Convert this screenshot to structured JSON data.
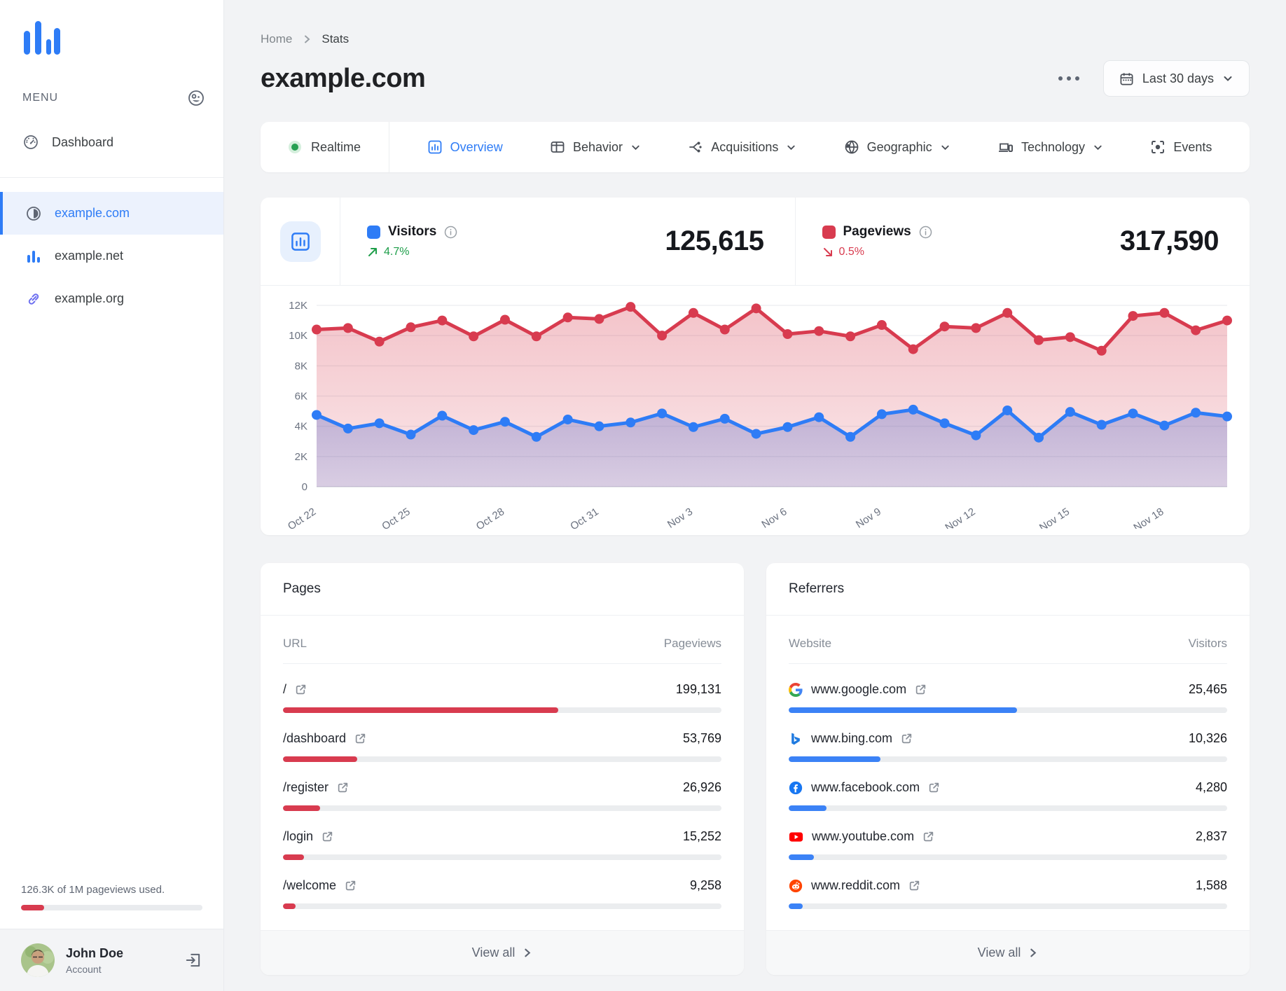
{
  "sidebar": {
    "menu_label": "MENU",
    "items": [
      {
        "label": "Dashboard",
        "icon": "gauge-icon"
      }
    ],
    "sites": [
      {
        "label": "example.com",
        "icon": "contrast-icon",
        "selected": true
      },
      {
        "label": "example.net",
        "icon": "bar-chart-icon",
        "selected": false
      },
      {
        "label": "example.org",
        "icon": "link-icon",
        "selected": false
      }
    ],
    "usage": {
      "text": "126.3K of 1M pageviews used.",
      "percent": 12.6
    },
    "account": {
      "name": "John Doe",
      "role": "Account"
    }
  },
  "header": {
    "breadcrumb": {
      "home": "Home",
      "current": "Stats"
    },
    "title": "example.com",
    "date_range": "Last 30 days"
  },
  "tabs": [
    {
      "label": "Realtime"
    },
    {
      "label": "Overview",
      "active": true
    },
    {
      "label": "Behavior",
      "dropdown": true
    },
    {
      "label": "Acquisitions",
      "dropdown": true
    },
    {
      "label": "Geographic",
      "dropdown": true
    },
    {
      "label": "Technology",
      "dropdown": true
    },
    {
      "label": "Events"
    }
  ],
  "stats": [
    {
      "label": "Visitors",
      "value": "125,615",
      "trend": "4.7%",
      "direction": "up",
      "color": "#2e7cf6"
    },
    {
      "label": "Pageviews",
      "value": "317,590",
      "trend": "0.5%",
      "direction": "down",
      "color": "#d83b4f"
    }
  ],
  "chart_data": {
    "type": "line",
    "x": [
      "Oct 22",
      "Oct 23",
      "Oct 24",
      "Oct 25",
      "Oct 26",
      "Oct 27",
      "Oct 28",
      "Oct 29",
      "Oct 30",
      "Oct 31",
      "Nov 1",
      "Nov 2",
      "Nov 3",
      "Nov 4",
      "Nov 5",
      "Nov 6",
      "Nov 7",
      "Nov 8",
      "Nov 9",
      "Nov 10",
      "Nov 11",
      "Nov 12",
      "Nov 13",
      "Nov 14",
      "Nov 15",
      "Nov 16",
      "Nov 17",
      "Nov 18",
      "Nov 19",
      "Nov 20"
    ],
    "label_every": 3,
    "shown_x_labels": [
      "Oct 22",
      "Oct 25",
      "Oct 28",
      "Oct 31",
      "Nov 3",
      "Nov 6",
      "Nov 9",
      "Nov 12",
      "Nov 15",
      "Nov 18"
    ],
    "series": [
      {
        "name": "Pageviews",
        "color": "#d83b4f",
        "values": [
          10400,
          10500,
          9600,
          10550,
          11000,
          9950,
          11050,
          9950,
          11200,
          11100,
          11900,
          10000,
          11500,
          10400,
          11800,
          10100,
          10300,
          9950,
          10700,
          9100,
          10600,
          10500,
          11500,
          9700,
          9900,
          9000,
          11300,
          11500,
          10350,
          11000
        ]
      },
      {
        "name": "Visitors",
        "color": "#2e7cf6",
        "values": [
          4750,
          3850,
          4200,
          3450,
          4700,
          3750,
          4300,
          3300,
          4450,
          4000,
          4250,
          4850,
          3950,
          4500,
          3500,
          3950,
          4600,
          3300,
          4800,
          5100,
          4200,
          3400,
          5050,
          3250,
          4950,
          4100,
          4850,
          4050,
          4900,
          4650
        ]
      }
    ],
    "ylim": [
      0,
      12000
    ],
    "yticks": [
      "0",
      "2K",
      "4K",
      "6K",
      "8K",
      "10K",
      "12K"
    ],
    "grid": true,
    "legend_position": "top-header"
  },
  "pages": {
    "title": "Pages",
    "columns": [
      "URL",
      "Pageviews"
    ],
    "rows": [
      {
        "url": "/",
        "value": "199,131",
        "percent": 62.7
      },
      {
        "url": "/dashboard",
        "value": "53,769",
        "percent": 16.9
      },
      {
        "url": "/register",
        "value": "26,926",
        "percent": 8.5
      },
      {
        "url": "/login",
        "value": "15,252",
        "percent": 4.8
      },
      {
        "url": "/welcome",
        "value": "9,258",
        "percent": 2.9
      }
    ],
    "view_all": "View all"
  },
  "referrers": {
    "title": "Referrers",
    "columns": [
      "Website",
      "Visitors"
    ],
    "rows": [
      {
        "site": "www.google.com",
        "icon": "google-favicon",
        "value": "25,465",
        "percent": 52.0
      },
      {
        "site": "www.bing.com",
        "icon": "bing-favicon",
        "value": "10,326",
        "percent": 21.0
      },
      {
        "site": "www.facebook.com",
        "icon": "facebook-favicon",
        "value": "4,280",
        "percent": 8.7
      },
      {
        "site": "www.youtube.com",
        "icon": "youtube-favicon",
        "value": "2,837",
        "percent": 5.8
      },
      {
        "site": "www.reddit.com",
        "icon": "reddit-favicon",
        "value": "1,588",
        "percent": 3.2
      }
    ],
    "view_all": "View all"
  },
  "colors": {
    "accent_blue": "#2e7cf6",
    "accent_red": "#d83b4f",
    "green": "#1e9e4a",
    "indigo": "#6d6ff0"
  }
}
